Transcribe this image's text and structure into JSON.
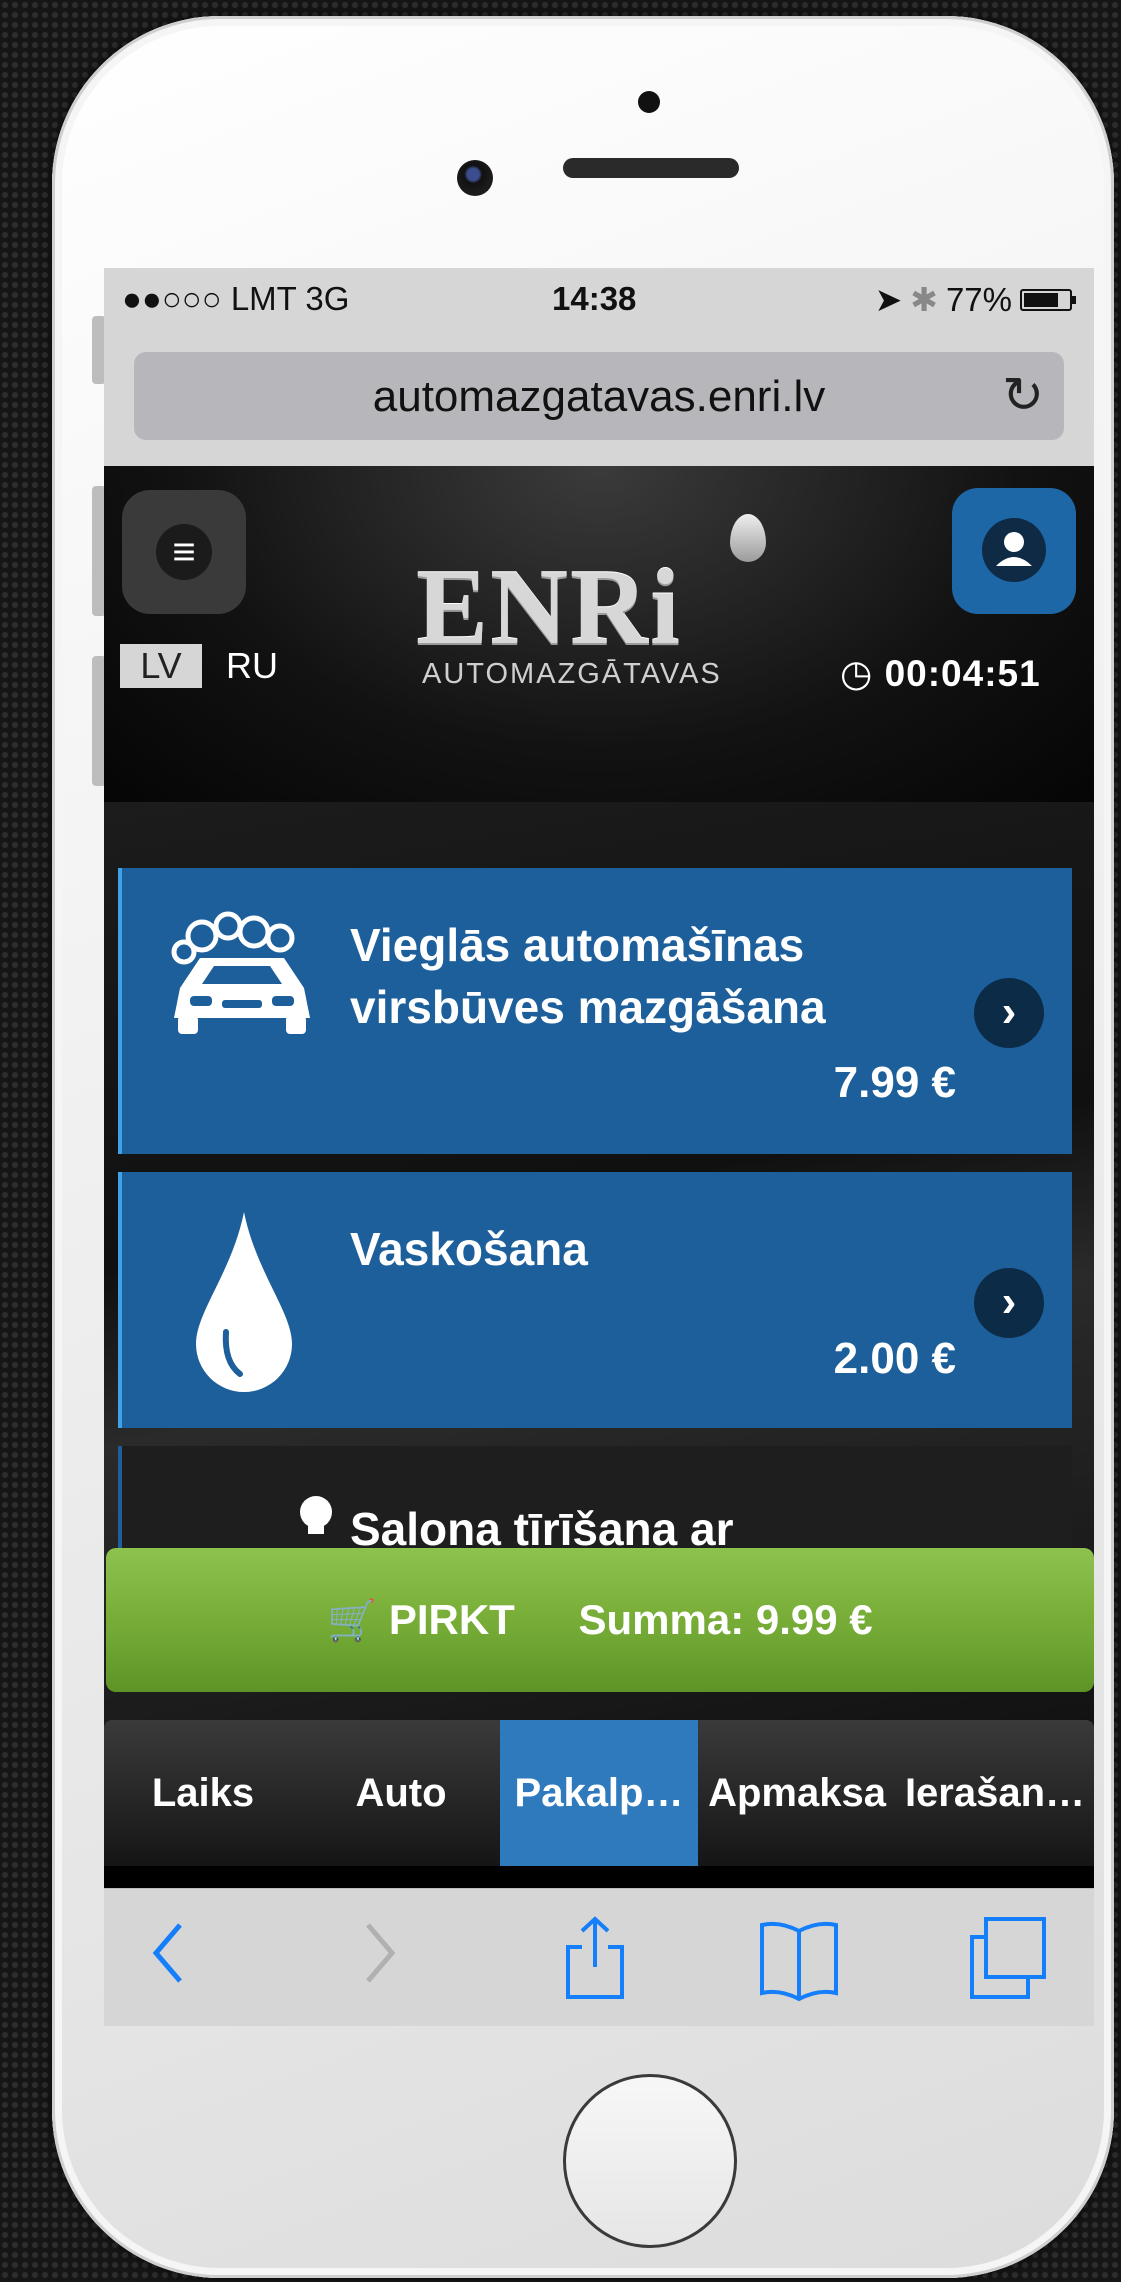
{
  "status_bar": {
    "carrier": "●●○○○ LMT   3G",
    "time": "14:38",
    "battery": "77%"
  },
  "browser": {
    "url": "automazgatavas.enri.lv"
  },
  "header": {
    "logo_text": "ENRi",
    "logo_subtitle": "AUTOMAZGĀTAVAS",
    "lang_active": "LV",
    "lang_other": "RU",
    "timer": "00:04:51"
  },
  "services": [
    {
      "title": "Vieglās automašīnas virsbūves mazgāšana",
      "price": "7.99 €",
      "icon": "car-wash-icon"
    },
    {
      "title": "Vaskošana",
      "price": "2.00 €",
      "icon": "water-drop-icon"
    },
    {
      "title": "Salona tīrīšana ar",
      "price": "",
      "icon": "bulb-icon"
    }
  ],
  "buy_bar": {
    "button_label": "PIRKT",
    "summary": "Summa: 9.99 €"
  },
  "steps": [
    {
      "label": "Laiks",
      "active": false
    },
    {
      "label": "Auto",
      "active": false
    },
    {
      "label": "Pakalp…",
      "active": true
    },
    {
      "label": "Apmaksa",
      "active": false
    },
    {
      "label": "Ierašan…",
      "active": false
    }
  ],
  "colors": {
    "card_blue": "#1d5f9b",
    "active_tab": "#2f79bd",
    "buy_green": "#77ad37",
    "ios_blue": "#147efb"
  }
}
